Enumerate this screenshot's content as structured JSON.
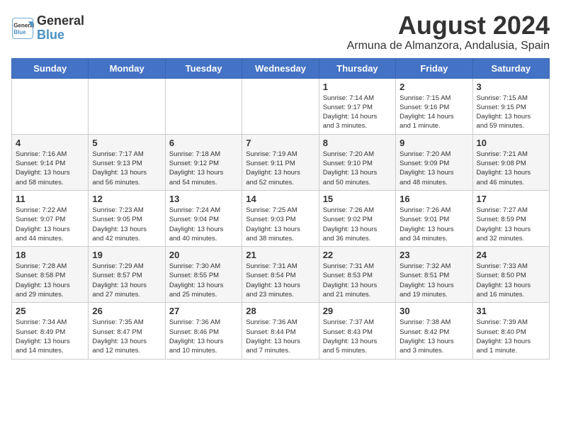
{
  "header": {
    "logo_line1": "General",
    "logo_line2": "Blue",
    "main_title": "August 2024",
    "subtitle": "Armuna de Almanzora, Andalusia, Spain"
  },
  "days_of_week": [
    "Sunday",
    "Monday",
    "Tuesday",
    "Wednesday",
    "Thursday",
    "Friday",
    "Saturday"
  ],
  "weeks": [
    [
      {
        "day": "",
        "info": ""
      },
      {
        "day": "",
        "info": ""
      },
      {
        "day": "",
        "info": ""
      },
      {
        "day": "",
        "info": ""
      },
      {
        "day": "1",
        "info": "Sunrise: 7:14 AM\nSunset: 9:17 PM\nDaylight: 14 hours\nand 3 minutes."
      },
      {
        "day": "2",
        "info": "Sunrise: 7:15 AM\nSunset: 9:16 PM\nDaylight: 14 hours\nand 1 minute."
      },
      {
        "day": "3",
        "info": "Sunrise: 7:15 AM\nSunset: 9:15 PM\nDaylight: 13 hours\nand 59 minutes."
      }
    ],
    [
      {
        "day": "4",
        "info": "Sunrise: 7:16 AM\nSunset: 9:14 PM\nDaylight: 13 hours\nand 58 minutes."
      },
      {
        "day": "5",
        "info": "Sunrise: 7:17 AM\nSunset: 9:13 PM\nDaylight: 13 hours\nand 56 minutes."
      },
      {
        "day": "6",
        "info": "Sunrise: 7:18 AM\nSunset: 9:12 PM\nDaylight: 13 hours\nand 54 minutes."
      },
      {
        "day": "7",
        "info": "Sunrise: 7:19 AM\nSunset: 9:11 PM\nDaylight: 13 hours\nand 52 minutes."
      },
      {
        "day": "8",
        "info": "Sunrise: 7:20 AM\nSunset: 9:10 PM\nDaylight: 13 hours\nand 50 minutes."
      },
      {
        "day": "9",
        "info": "Sunrise: 7:20 AM\nSunset: 9:09 PM\nDaylight: 13 hours\nand 48 minutes."
      },
      {
        "day": "10",
        "info": "Sunrise: 7:21 AM\nSunset: 9:08 PM\nDaylight: 13 hours\nand 46 minutes."
      }
    ],
    [
      {
        "day": "11",
        "info": "Sunrise: 7:22 AM\nSunset: 9:07 PM\nDaylight: 13 hours\nand 44 minutes."
      },
      {
        "day": "12",
        "info": "Sunrise: 7:23 AM\nSunset: 9:05 PM\nDaylight: 13 hours\nand 42 minutes."
      },
      {
        "day": "13",
        "info": "Sunrise: 7:24 AM\nSunset: 9:04 PM\nDaylight: 13 hours\nand 40 minutes."
      },
      {
        "day": "14",
        "info": "Sunrise: 7:25 AM\nSunset: 9:03 PM\nDaylight: 13 hours\nand 38 minutes."
      },
      {
        "day": "15",
        "info": "Sunrise: 7:26 AM\nSunset: 9:02 PM\nDaylight: 13 hours\nand 36 minutes."
      },
      {
        "day": "16",
        "info": "Sunrise: 7:26 AM\nSunset: 9:01 PM\nDaylight: 13 hours\nand 34 minutes."
      },
      {
        "day": "17",
        "info": "Sunrise: 7:27 AM\nSunset: 8:59 PM\nDaylight: 13 hours\nand 32 minutes."
      }
    ],
    [
      {
        "day": "18",
        "info": "Sunrise: 7:28 AM\nSunset: 8:58 PM\nDaylight: 13 hours\nand 29 minutes."
      },
      {
        "day": "19",
        "info": "Sunrise: 7:29 AM\nSunset: 8:57 PM\nDaylight: 13 hours\nand 27 minutes."
      },
      {
        "day": "20",
        "info": "Sunrise: 7:30 AM\nSunset: 8:55 PM\nDaylight: 13 hours\nand 25 minutes."
      },
      {
        "day": "21",
        "info": "Sunrise: 7:31 AM\nSunset: 8:54 PM\nDaylight: 13 hours\nand 23 minutes."
      },
      {
        "day": "22",
        "info": "Sunrise: 7:31 AM\nSunset: 8:53 PM\nDaylight: 13 hours\nand 21 minutes."
      },
      {
        "day": "23",
        "info": "Sunrise: 7:32 AM\nSunset: 8:51 PM\nDaylight: 13 hours\nand 19 minutes."
      },
      {
        "day": "24",
        "info": "Sunrise: 7:33 AM\nSunset: 8:50 PM\nDaylight: 13 hours\nand 16 minutes."
      }
    ],
    [
      {
        "day": "25",
        "info": "Sunrise: 7:34 AM\nSunset: 8:49 PM\nDaylight: 13 hours\nand 14 minutes."
      },
      {
        "day": "26",
        "info": "Sunrise: 7:35 AM\nSunset: 8:47 PM\nDaylight: 13 hours\nand 12 minutes."
      },
      {
        "day": "27",
        "info": "Sunrise: 7:36 AM\nSunset: 8:46 PM\nDaylight: 13 hours\nand 10 minutes."
      },
      {
        "day": "28",
        "info": "Sunrise: 7:36 AM\nSunset: 8:44 PM\nDaylight: 13 hours\nand 7 minutes."
      },
      {
        "day": "29",
        "info": "Sunrise: 7:37 AM\nSunset: 8:43 PM\nDaylight: 13 hours\nand 5 minutes."
      },
      {
        "day": "30",
        "info": "Sunrise: 7:38 AM\nSunset: 8:42 PM\nDaylight: 13 hours\nand 3 minutes."
      },
      {
        "day": "31",
        "info": "Sunrise: 7:39 AM\nSunset: 8:40 PM\nDaylight: 13 hours\nand 1 minute."
      }
    ]
  ]
}
